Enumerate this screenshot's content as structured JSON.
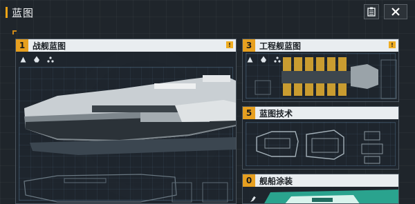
{
  "window": {
    "title": "蓝图"
  },
  "header": {
    "notes_icon": "clipboard-icon",
    "close_icon": "close-icon"
  },
  "panels": {
    "warship": {
      "number": "1",
      "title": "战舰蓝图",
      "badge": "!",
      "filters": [
        "triangle-filter-icon",
        "ship-silhouette-icon",
        "three-dots-icon"
      ]
    },
    "engineering": {
      "number": "3",
      "title": "工程舰蓝图",
      "badge": "!",
      "filters": [
        "triangle-filter-icon",
        "ship-silhouette-icon",
        "three-dots-icon"
      ]
    },
    "tech": {
      "number": "5",
      "title": "蓝图技术"
    },
    "paint": {
      "number": "0",
      "title": "舰船涂装"
    }
  },
  "colors": {
    "accent": "#e7a020",
    "header_bg": "#e9edf0",
    "panel_bg": "#1e262e",
    "border": "#4c5660"
  }
}
